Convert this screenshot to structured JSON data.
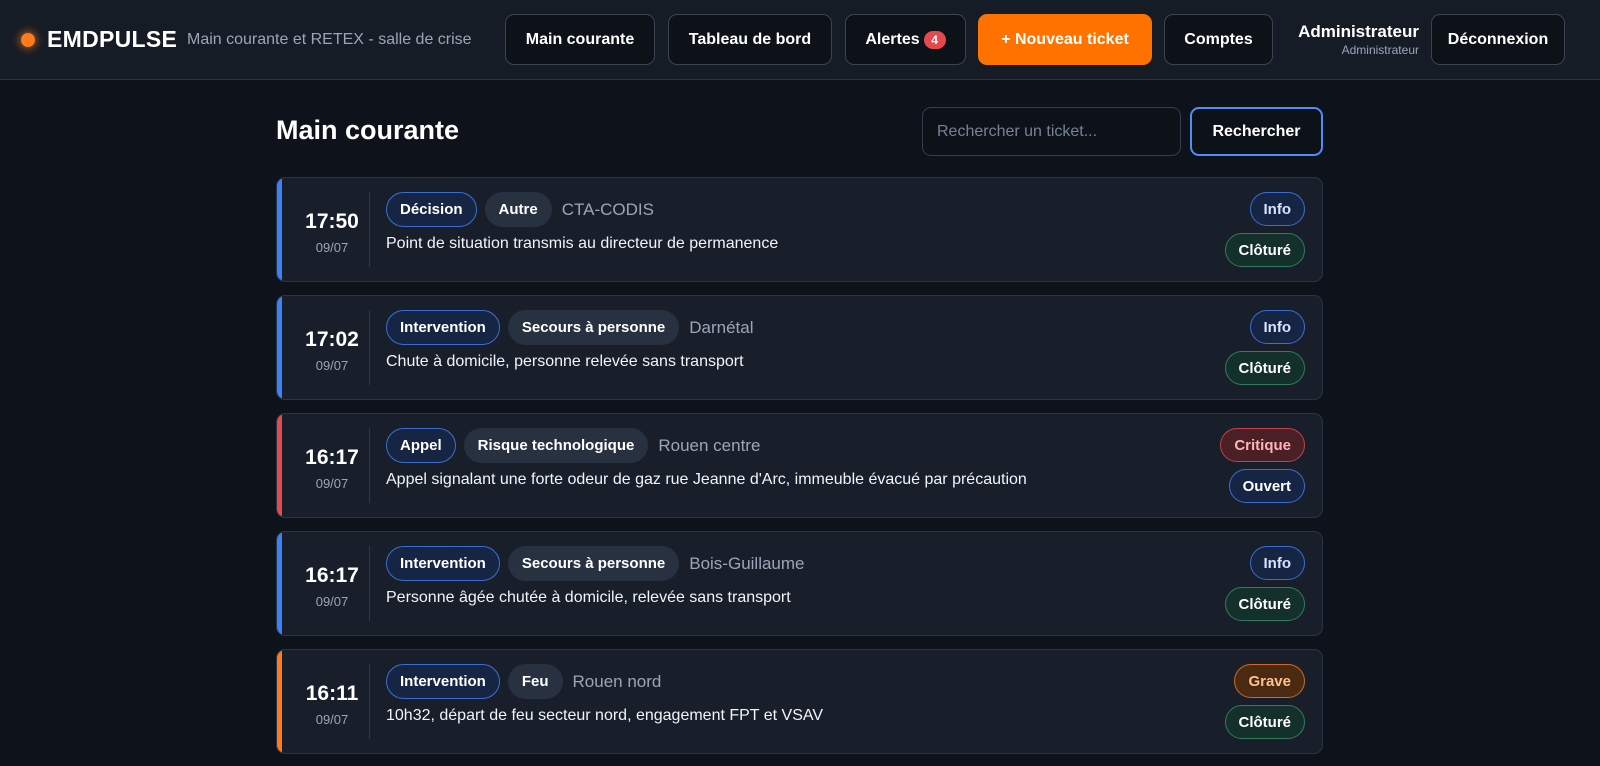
{
  "app": {
    "name": "EMDPULSE",
    "subtitle": "Main courante et RETEX - salle de crise"
  },
  "nav": {
    "main_courante": "Main courante",
    "tableau_de_bord": "Tableau de bord",
    "alertes": "Alertes",
    "alertes_count": "4",
    "nouveau_ticket": "+ Nouveau ticket",
    "comptes": "Comptes",
    "deconnexion": "Déconnexion"
  },
  "user": {
    "name": "Administrateur",
    "role": "Administrateur"
  },
  "page": {
    "title": "Main courante",
    "search_placeholder": "Rechercher un ticket...",
    "search_value": "",
    "search_button": "Rechercher"
  },
  "colors": {
    "brand_accent": "#ff7200",
    "info": "#3b82f6",
    "critique": "#e5484d",
    "grave": "#ff7a1a",
    "cloture": "#2f7d5b",
    "ouvert": "#3c6ed1"
  },
  "tickets": [
    {
      "time": "17:50",
      "date": "09/07",
      "type": "Décision",
      "category": "Autre",
      "location": "CTA-CODIS",
      "description": "Point de situation transmis au directeur de permanence",
      "severity": "Info",
      "status": "Clôturé"
    },
    {
      "time": "17:02",
      "date": "09/07",
      "type": "Intervention",
      "category": "Secours à personne",
      "location": "Darnétal",
      "description": "Chute à domicile, personne relevée sans transport",
      "severity": "Info",
      "status": "Clôturé"
    },
    {
      "time": "16:17",
      "date": "09/07",
      "type": "Appel",
      "category": "Risque technologique",
      "location": "Rouen centre",
      "description": "Appel signalant une forte odeur de gaz rue Jeanne d'Arc, immeuble évacué par précaution",
      "severity": "Critique",
      "status": "Ouvert"
    },
    {
      "time": "16:17",
      "date": "09/07",
      "type": "Intervention",
      "category": "Secours à personne",
      "location": "Bois-Guillaume",
      "description": "Personne âgée chutée à domicile, relevée sans transport",
      "severity": "Info",
      "status": "Clôturé"
    },
    {
      "time": "16:11",
      "date": "09/07",
      "type": "Intervention",
      "category": "Feu",
      "location": "Rouen nord",
      "description": "10h32, départ de feu secteur nord, engagement FPT et VSAV",
      "severity": "Grave",
      "status": "Clôturé"
    }
  ]
}
